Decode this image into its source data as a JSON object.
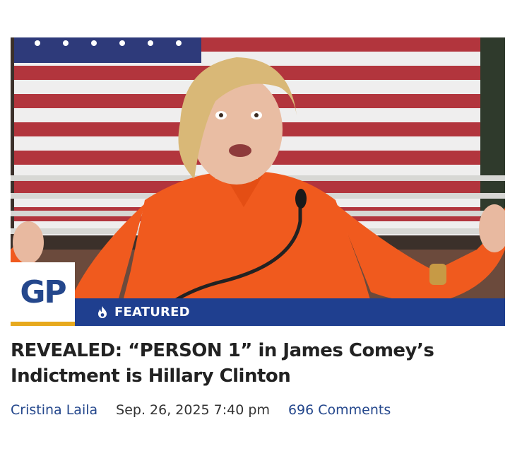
{
  "article": {
    "badge_logo": "GP",
    "badge_label": "FEATURED",
    "badge_icon": "fire-icon",
    "title": "REVEALED: “PERSON 1” in James Comey’s Indictment is Hillary Clinton",
    "author": "Cristina Laila",
    "date": "Sep. 26, 2025 7:40 pm",
    "comments": "696 Comments"
  },
  "colors": {
    "brand_blue": "#1f3f8f",
    "logo_gold": "#e7a91d",
    "link_blue": "#24478c",
    "headline": "#222222"
  }
}
